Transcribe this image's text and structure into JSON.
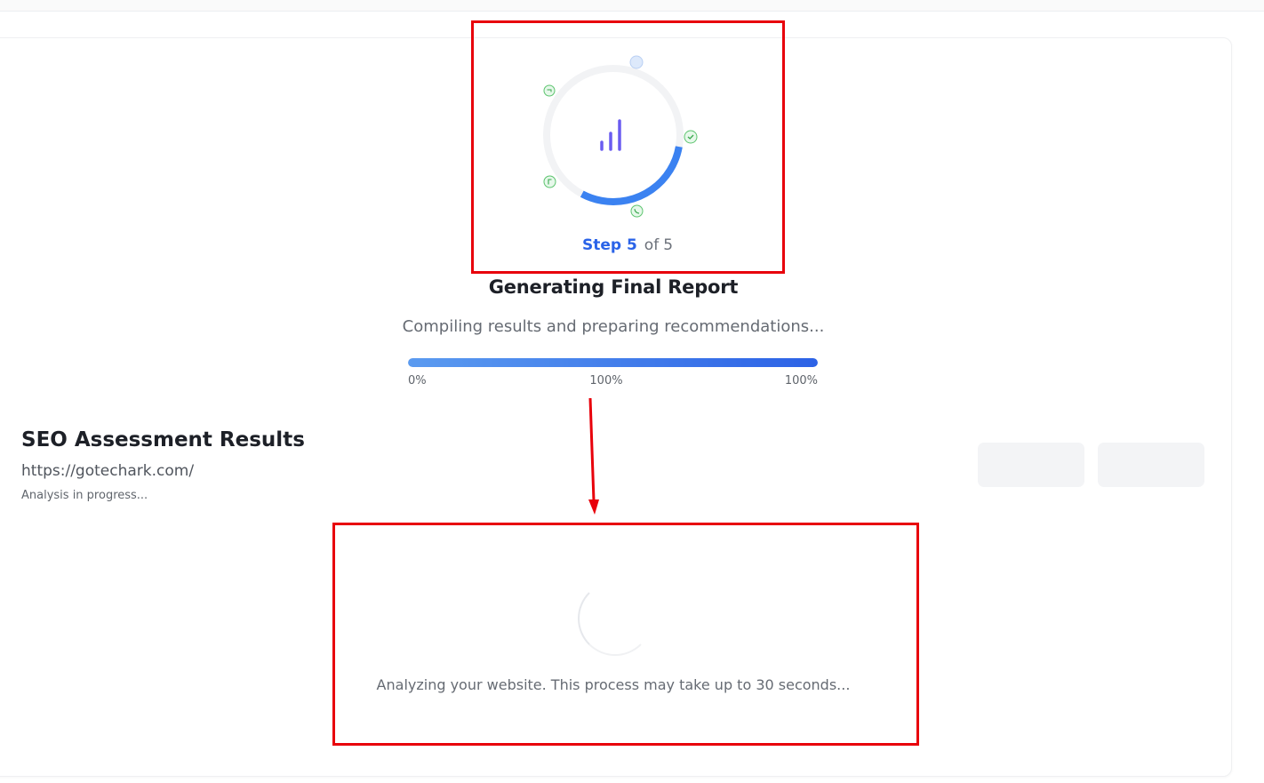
{
  "progress_panel": {
    "step_current": "Step 5",
    "step_of": "of",
    "step_total": "5",
    "stage_title": "Generating Final Report",
    "stage_description": "Compiling results and preparing recommendations...",
    "progress_fraction": 1.0,
    "progress_label_start": "0%",
    "progress_label_mid": "100%",
    "progress_label_end": "100%",
    "ring_progress_fraction": 0.3,
    "accent_color": "#2a63e8",
    "node_icons": [
      "clock-icon",
      "check-icon",
      "phone-icon",
      "refresh-icon",
      "sync-icon"
    ]
  },
  "results": {
    "title": "SEO Assessment Results",
    "url": "https://gotechark.com/",
    "status": "Analysis in progress..."
  },
  "loading": {
    "message": "Analyzing your website. This process may take up to 30 seconds..."
  },
  "annotation": {
    "highlight_color": "#e8000b"
  }
}
